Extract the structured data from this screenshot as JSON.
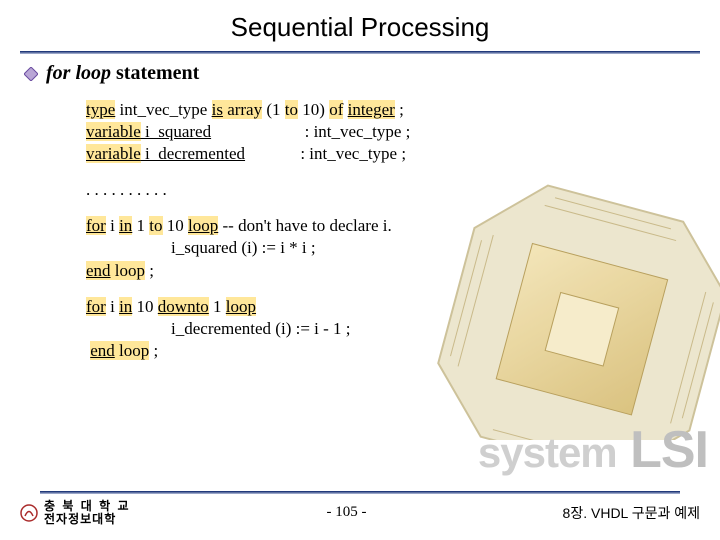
{
  "title": "Sequential Processing",
  "heading_loop": "for loop",
  "heading_stmt": " statement",
  "code": {
    "block1": {
      "l1_kw1": "type",
      "l1_mid": " int_vec_type ",
      "l1_kw2": "is",
      "l1_kw3": " array",
      "l1_mid2": " (1 ",
      "l1_kw4": "to",
      "l1_mid3": " 10) ",
      "l1_kw5": "of",
      "l1_mid4": "  ",
      "l1_kw6": "integer",
      "l1_end": " ;",
      "l2_kw": "variable",
      "l2_name": " i_squared",
      "l2_type": "                      : int_vec_type ;",
      "l3_kw": "variable",
      "l3_name": " i_decremented",
      "l3_type": "             : int_vec_type ;"
    },
    "dots": ". . . . . . . . . .",
    "block2": {
      "l1_kw1": "for",
      "l1_mid1": " i ",
      "l1_kw2": "in",
      "l1_mid2": " 1 ",
      "l1_kw3": "to",
      "l1_mid3": " 10 ",
      "l1_kw4": "loop",
      "l1_cmt": "  -- don't have to declare i.",
      "l2": "                    i_squared (i) := i * i ;",
      "l3_kw1": "end",
      "l3_kw2": " loop",
      "l3_end": " ;"
    },
    "block3": {
      "l1_kw1": "for",
      "l1_mid1": " i ",
      "l1_kw2": "in",
      "l1_mid2": " 10 ",
      "l1_kw3": "downto",
      "l1_mid3": " 1 ",
      "l1_kw4": "loop",
      "l2": "                    i_decremented (i) := i - 1 ;",
      "l3_sp": " ",
      "l3_kw1": "end",
      "l3_kw2": " loop",
      "l3_end": " ;"
    }
  },
  "watermark1": "system",
  "watermark2": " LSI",
  "footer": {
    "kor1": "충 북 대 학 교",
    "kor2": "전자정보대학",
    "page": "-  105  -",
    "chapter": "8장. VHDL 구문과 예제"
  }
}
